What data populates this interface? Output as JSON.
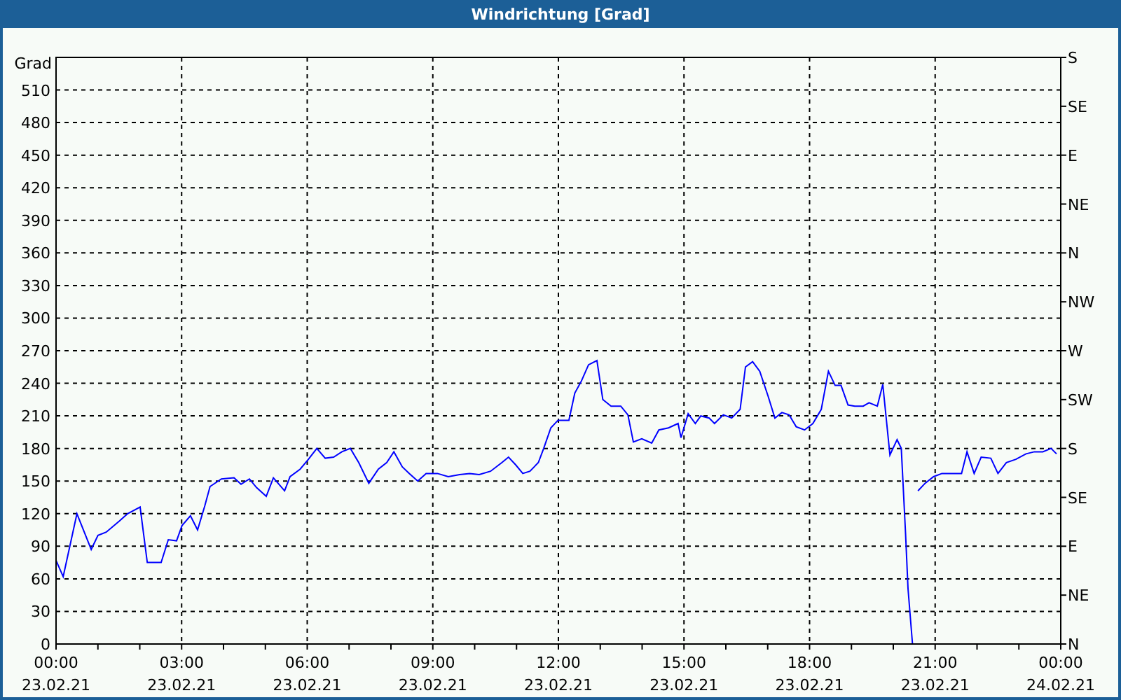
{
  "window": {
    "title": "Windrichtung [Grad]"
  },
  "chart": {
    "chart_data": {
      "type": "line",
      "grid": true,
      "ylabel": "Grad",
      "xlim": [
        0,
        24
      ],
      "ylim": [
        0,
        540
      ],
      "x": [
        0,
        0.17,
        0.5,
        0.84,
        1.0,
        1.2,
        1.51,
        1.71,
        2.01,
        2.18,
        2.51,
        2.68,
        2.88,
        3.01,
        3.21,
        3.38,
        3.55,
        3.68,
        3.95,
        4.25,
        4.42,
        4.62,
        4.79,
        5.02,
        5.19,
        5.46,
        5.59,
        5.83,
        6.03,
        6.23,
        6.43,
        6.63,
        6.83,
        7.03,
        7.23,
        7.47,
        7.7,
        7.9,
        8.07,
        8.27,
        8.44,
        8.64,
        8.84,
        9.11,
        9.37,
        9.64,
        9.88,
        10.11,
        10.38,
        10.65,
        10.81,
        10.98,
        11.15,
        11.32,
        11.52,
        11.65,
        11.82,
        11.99,
        12.25,
        12.39,
        12.55,
        12.72,
        12.92,
        13.06,
        13.26,
        13.49,
        13.66,
        13.79,
        13.99,
        14.23,
        14.4,
        14.63,
        14.86,
        14.93,
        15.1,
        15.27,
        15.4,
        15.6,
        15.73,
        15.94,
        16.14,
        16.34,
        16.47,
        16.64,
        16.81,
        17.01,
        17.17,
        17.34,
        17.51,
        17.68,
        17.88,
        18.08,
        18.28,
        18.45,
        18.61,
        18.75,
        18.92,
        19.08,
        19.28,
        19.42,
        19.62,
        19.75,
        19.92,
        20.09,
        20.19,
        20.29,
        20.35,
        20.46,
        20.52,
        20.59,
        20.76,
        20.96,
        21.16,
        21.43,
        21.63,
        21.76,
        21.93,
        22.1,
        22.33,
        22.5,
        22.7,
        22.93,
        23.17,
        23.37,
        23.57,
        23.77,
        23.9
      ],
      "series": [
        {
          "color": "#0000ff",
          "values": [
            77,
            62,
            120,
            87,
            100,
            103,
            113,
            120,
            126,
            75,
            75,
            96,
            95,
            109,
            118,
            105,
            127,
            145,
            152,
            153,
            147,
            152,
            144,
            136,
            153,
            141,
            154,
            161,
            170,
            180,
            171,
            172,
            177,
            180,
            167,
            148,
            161,
            167,
            177,
            163,
            157,
            150,
            157,
            157,
            154,
            156,
            157,
            156,
            159,
            167,
            172,
            165,
            157,
            159,
            167,
            180,
            199,
            206,
            206,
            231,
            242,
            257,
            261,
            225,
            219,
            219,
            211,
            186,
            189,
            185,
            197,
            199,
            203,
            190,
            212,
            203,
            210,
            208,
            203,
            211,
            208,
            216,
            255,
            260,
            251,
            228,
            208,
            213,
            211,
            200,
            197,
            203,
            216,
            251,
            238,
            238,
            220,
            219,
            219,
            222,
            219,
            239,
            174,
            188,
            180,
            103,
            51,
            0,
            null,
            141,
            148,
            154,
            157,
            157,
            157,
            177,
            157,
            172,
            171,
            157,
            167,
            170,
            175,
            177,
            177,
            180,
            175
          ]
        }
      ],
      "xticks": [
        {
          "value": 0,
          "label": "00:00"
        },
        {
          "value": 3,
          "label": "03:00"
        },
        {
          "value": 6,
          "label": "06:00"
        },
        {
          "value": 9,
          "label": "09:00"
        },
        {
          "value": 12,
          "label": "12:00"
        },
        {
          "value": 15,
          "label": "15:00"
        },
        {
          "value": 18,
          "label": "18:00"
        },
        {
          "value": 21,
          "label": "21:00"
        },
        {
          "value": 24,
          "label": "00:00"
        }
      ],
      "yticks": [
        0,
        30,
        60,
        90,
        120,
        150,
        180,
        210,
        240,
        270,
        300,
        330,
        360,
        390,
        420,
        450,
        480,
        510
      ]
    },
    "x_dates": [
      "23.02.21",
      "23.02.21",
      "23.02.21",
      "23.02.21",
      "23.02.21",
      "23.02.21",
      "23.02.21",
      "23.02.21",
      "24.02.21"
    ],
    "compass_axis": {
      "labels": [
        "S",
        "SE",
        "E",
        "NE",
        "N",
        "NW",
        "W",
        "SW",
        "S",
        "SE",
        "E",
        "NE",
        "N"
      ]
    }
  }
}
